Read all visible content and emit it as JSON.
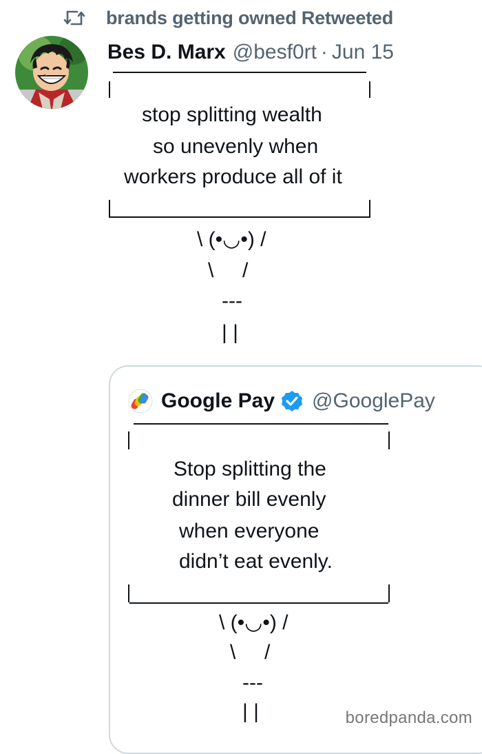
{
  "retweet_banner": {
    "text": "brands getting owned Retweeted"
  },
  "tweet": {
    "display_name": "Bes D. Marx",
    "handle": "@besf0rt",
    "separator": "·",
    "date": "Jun 15",
    "sign_lines": [
      "stop splitting wealth",
      "so unevenly when",
      "workers produce all of it"
    ],
    "bunny_lines": [
      "\\ (•◡•) /",
      "\\     /",
      "---",
      "| |"
    ]
  },
  "quoted_tweet": {
    "display_name": "Google Pay",
    "handle": "@GooglePay",
    "sign_lines": [
      "Stop splitting the",
      "dinner bill evenly",
      "when everyone",
      "didn’t eat evenly."
    ],
    "bunny_lines": [
      "\\ (•◡•) /",
      "\\     /",
      "---",
      "| |"
    ]
  },
  "watermark": "boredpanda.com",
  "colors": {
    "text": "#0f1419",
    "secondary": "#536471",
    "verified": "#1d9bf0",
    "card_border": "#cfd9de"
  }
}
